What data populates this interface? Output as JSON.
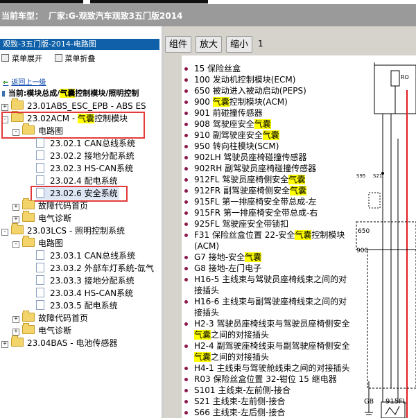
{
  "header": {
    "label": "当前车型：",
    "value": "厂家:G-观致汽车观致3五门版2014"
  },
  "left_panel": {
    "title": "观致-3五门版-2014-电路图",
    "expand_label": "菜单展开",
    "collapse_label": "菜单折叠",
    "back_label": "返回上一级",
    "current_path": {
      "prefix": "当前:模块总成/",
      "highlight": "气囊",
      "suffix": "控制模块/照明控制"
    },
    "tree": [
      {
        "pm": "+",
        "text_a": "23.01ABS_ESC_EPB - ABS ES",
        "hl": "",
        "text_b": ""
      },
      {
        "pm": "-",
        "text_a": "23.02ACM - ",
        "hl": "气囊",
        "text_b": "控制模块"
      },
      {
        "pm": "-",
        "text_a": "电路图",
        "hl": "",
        "text_b": ""
      },
      {
        "text_a": "23.02.1 CAN总线系统"
      },
      {
        "text_a": "23.02.2 接地分配系统"
      },
      {
        "text_a": "23.02.3 HS-CAN系统"
      },
      {
        "text_a": "23.02.4 配电系统"
      },
      {
        "text_a": "23.02.6 安全系统"
      },
      {
        "pm": "+",
        "text_a": "故障代码首页"
      },
      {
        "pm": "+",
        "text_a": "电气诊断"
      },
      {
        "pm": "-",
        "text_a": "23.03LCS - 照明控制系统"
      },
      {
        "pm": "-",
        "text_a": "电路图"
      },
      {
        "text_a": "23.03.1 CAN总线系统"
      },
      {
        "text_a": "23.03.2 外部车灯系统-氙气"
      },
      {
        "text_a": "23.03.3 接地分配系统"
      },
      {
        "text_a": "23.03.4 HS-CAN系统"
      },
      {
        "text_a": "23.03.5 配电系统"
      },
      {
        "pm": "+",
        "text_a": "故障代码首页"
      },
      {
        "pm": "+",
        "text_a": "电气诊断"
      },
      {
        "pm": "+",
        "text_a": "23.04BAS - 电池传感器"
      }
    ]
  },
  "toolbar": {
    "components_label": "组件",
    "zoom_in_label": "放大",
    "zoom_out_label": "缩小",
    "page": "1"
  },
  "legend": [
    {
      "a": "15 保险丝盒",
      "hl": "",
      "b": ""
    },
    {
      "a": "100 发动机控制模块(ECM)",
      "hl": "",
      "b": ""
    },
    {
      "a": "650 被动进入被动启动(PEPS)",
      "hl": "",
      "b": ""
    },
    {
      "a": "900 ",
      "hl": "气囊",
      "b": "控制模块(ACM)"
    },
    {
      "a": "901 前碰撞传感器",
      "hl": "",
      "b": ""
    },
    {
      "a": "908 驾驶座安全",
      "hl": "气囊",
      "b": ""
    },
    {
      "a": "910 副驾驶座安全",
      "hl": "气囊",
      "b": ""
    },
    {
      "a": "950 转向柱模块(SCM)",
      "hl": "",
      "b": ""
    },
    {
      "a": "902LH 驾驶员座椅碰撞传感器",
      "hl": "",
      "b": ""
    },
    {
      "a": "902RH 副驾驶员座椅碰撞传感器",
      "hl": "",
      "b": ""
    },
    {
      "a": "912FL 驾驶员座椅侧安全",
      "hl": "气囊",
      "b": ""
    },
    {
      "a": "912FR 副驾驶座椅侧安全",
      "hl": "气囊",
      "b": ""
    },
    {
      "a": "915FL 第一排座椅安全带总成-左",
      "hl": "",
      "b": ""
    },
    {
      "a": "915FR 第一排座椅安全带总成-右",
      "hl": "",
      "b": ""
    },
    {
      "a": "925FL 驾驶座安全带锁扣",
      "hl": "",
      "b": ""
    },
    {
      "a": "F31 保险丝盒位置 22-安全",
      "hl": "气囊",
      "b": "控制模块(ACM)"
    },
    {
      "a": "G7 接地-安全",
      "hl": "气囊",
      "b": ""
    },
    {
      "a": "G8 接地-左门电子",
      "hl": "",
      "b": ""
    },
    {
      "a": "H16-5 主线束与驾驶员座椅线束之间的对接插头",
      "hl": "",
      "b": ""
    },
    {
      "a": "H16-6 主线束与副驾驶座椅线束之间的对接插头",
      "hl": "",
      "b": ""
    },
    {
      "a": "H2-3 驾驶员座椅线束与驾驶员座椅侧安全",
      "hl": "气囊",
      "b": "之间的对接插头"
    },
    {
      "a": "H2-4 副驾驶座椅线束与副驾驶座椅侧安全",
      "hl": "气囊",
      "b": "之间的对接插头"
    },
    {
      "a": "H4-1 主线束与驾驶舱线束之间的对接插头",
      "hl": "",
      "b": ""
    },
    {
      "a": "R03 保险丝盒位置 32-钳位 15 继电器",
      "hl": "",
      "b": ""
    },
    {
      "a": "S101 主线束-左前侧-接合",
      "hl": "",
      "b": ""
    },
    {
      "a": "S21 主线束-左前侧-接合",
      "hl": "",
      "b": ""
    },
    {
      "a": "S66 主线束-左后侧-接合",
      "hl": "",
      "b": ""
    }
  ],
  "schematic": {
    "labels": {
      "s95": "S95",
      "s21": "S21",
      "n650": "650",
      "n900": "900",
      "g8": "G8",
      "n915": "915FL",
      "ro": "RO"
    }
  },
  "colors": {
    "accent": "#0f60a8",
    "highlight": "#ffff00",
    "bullet": "#8b1a4a",
    "box": "#e23a3a",
    "wire": "#e31a1a"
  }
}
